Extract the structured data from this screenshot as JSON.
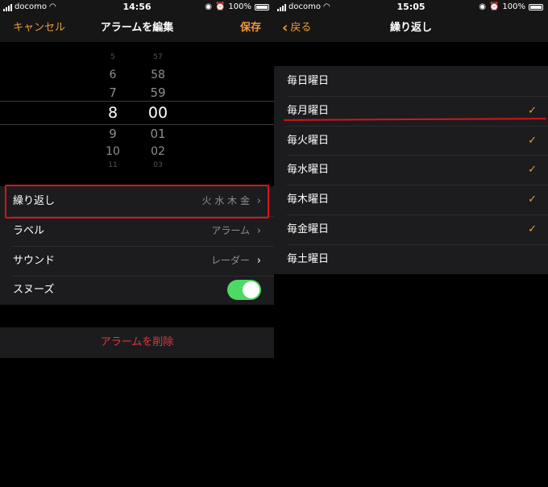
{
  "left_screen": {
    "status_bar": {
      "carrier": "docomo",
      "time": "14:56",
      "battery": "100%"
    },
    "nav": {
      "cancel_label": "キャンセル",
      "title": "アラームを編集",
      "save_label": "保存"
    },
    "picker": {
      "hours": [
        "5",
        "6",
        "7",
        "8",
        "9",
        "10",
        "11"
      ],
      "minutes": [
        "57",
        "58",
        "59",
        "00",
        "01",
        "02",
        "03"
      ],
      "selected_hour": "8",
      "selected_minute": "00"
    },
    "settings": {
      "repeat": {
        "label": "繰り返し",
        "value": "火 水 木 金"
      },
      "label": {
        "label": "ラベル",
        "value": "アラーム"
      },
      "sound": {
        "label": "サウンド",
        "value": "レーダー"
      },
      "snooze": {
        "label": "スヌーズ",
        "enabled": true
      }
    },
    "delete_label": "アラームを削除"
  },
  "right_screen": {
    "status_bar": {
      "carrier": "docomo",
      "time": "15:05",
      "battery": "100%"
    },
    "nav": {
      "back_label": "戻る",
      "title": "繰り返し"
    },
    "days": [
      {
        "label": "毎日曜日",
        "checked": false
      },
      {
        "label": "毎月曜日",
        "checked": true
      },
      {
        "label": "毎火曜日",
        "checked": true
      },
      {
        "label": "毎水曜日",
        "checked": true
      },
      {
        "label": "毎木曜日",
        "checked": true
      },
      {
        "label": "毎金曜日",
        "checked": true
      },
      {
        "label": "毎土曜日",
        "checked": false
      }
    ]
  },
  "colors": {
    "accent": "#f09a37",
    "destructive": "#e0383e",
    "toggle_on": "#4cd964",
    "annotation": "#d7141b"
  },
  "icons": {
    "check": "✓",
    "chevron": "›",
    "back_chevron": "‹"
  }
}
